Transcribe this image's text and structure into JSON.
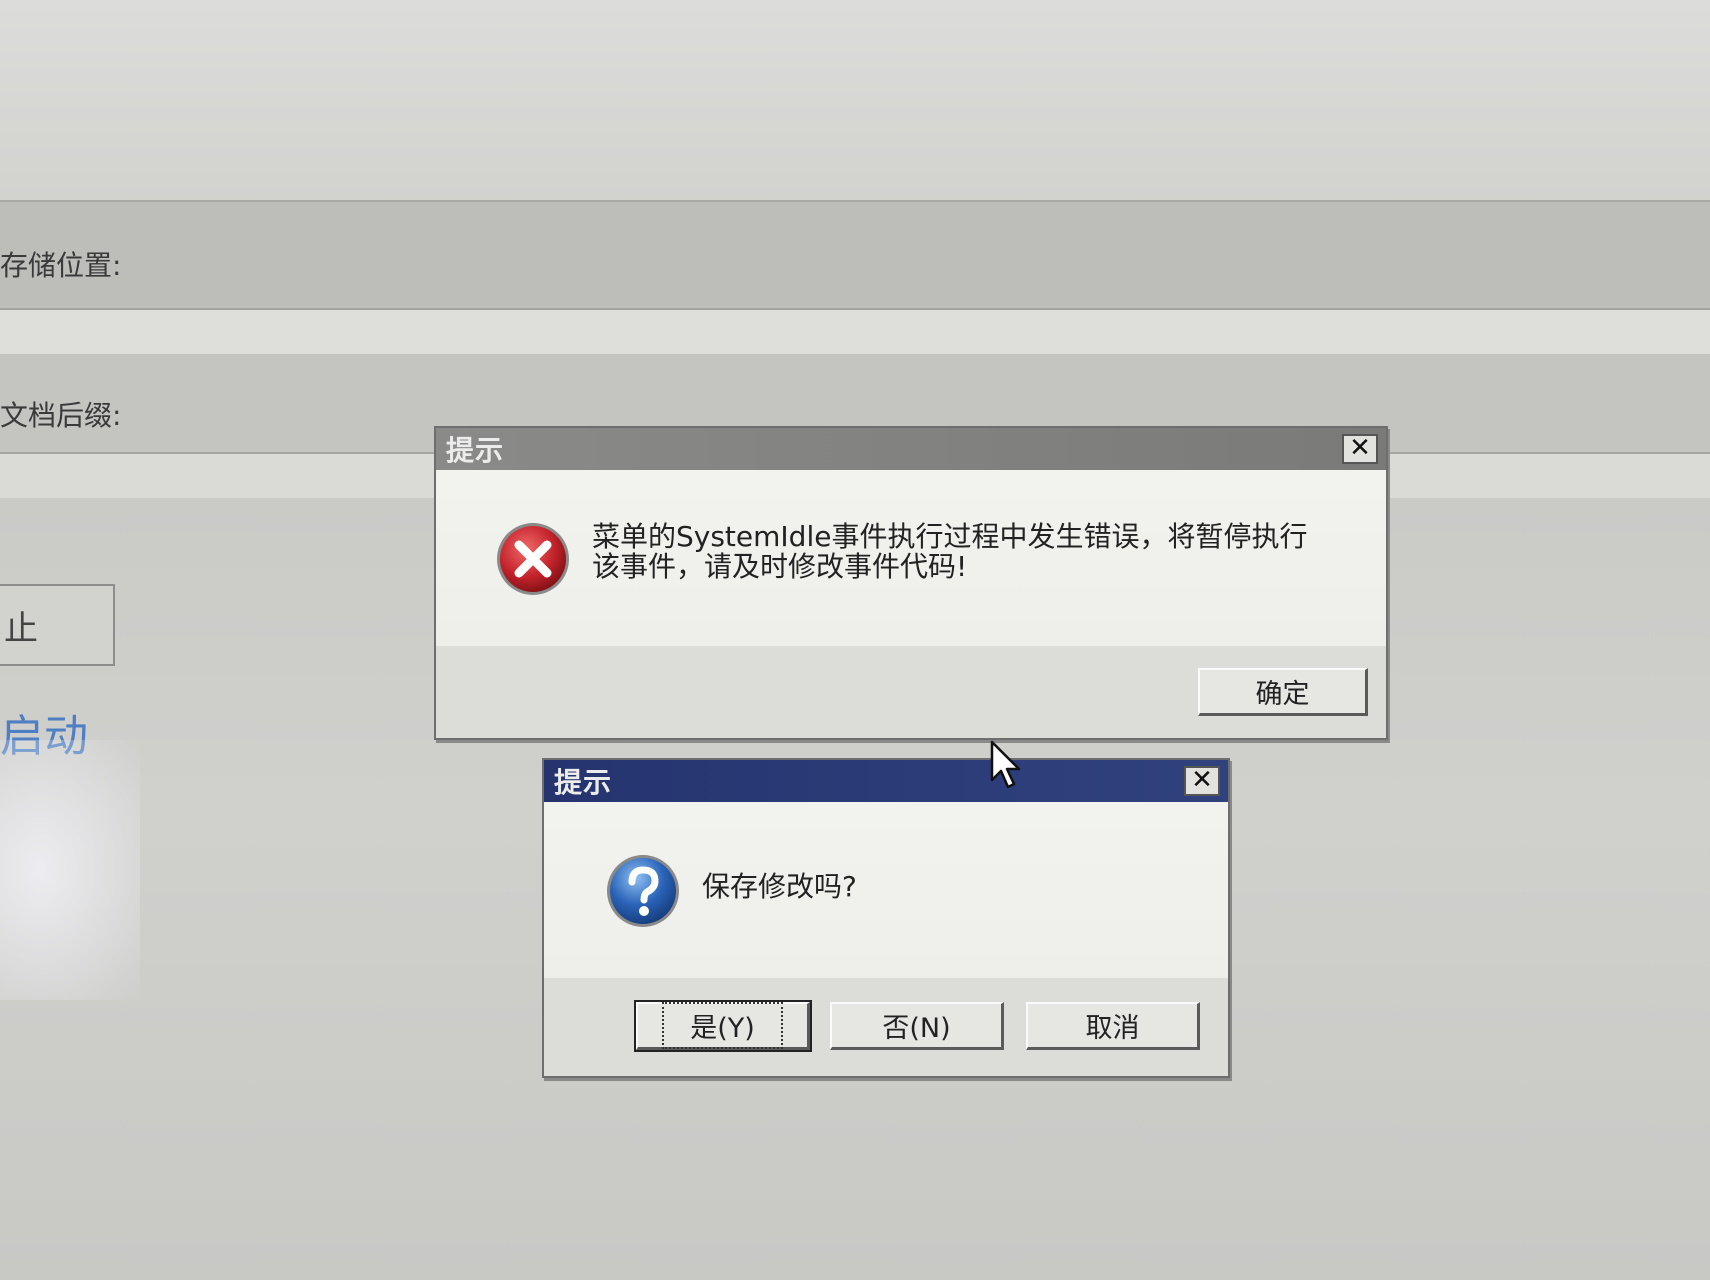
{
  "background_window": {
    "storage_label": "存储位置:",
    "suffix_label": "文档后缀:",
    "partial_button_label": "止",
    "partial_link_text": "启动"
  },
  "error_dialog": {
    "title": "提示",
    "close_label": "✕",
    "message": "菜单的SystemIdle事件执行过程中发生错误，将暂停执行该事件，请及时修改事件代码!",
    "ok_label": "确定",
    "icon": "error-icon"
  },
  "question_dialog": {
    "title": "提示",
    "close_label": "✕",
    "message": "保存修改吗?",
    "yes_label": "是(Y)",
    "no_label": "否(N)",
    "cancel_label": "取消",
    "icon": "question-icon"
  },
  "colors": {
    "active_titlebar": "#25346f",
    "inactive_titlebar": "#8a8a88",
    "error_red": "#c4232b",
    "question_blue": "#2a63b8",
    "link_blue": "#4e7fc4"
  }
}
